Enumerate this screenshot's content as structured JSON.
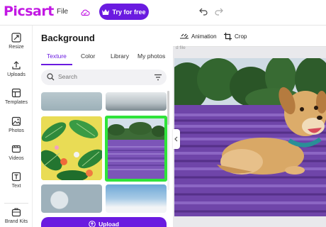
{
  "topbar": {
    "logo": "Picsart",
    "file_menu": "File",
    "try_button": "Try for free"
  },
  "rail": {
    "items": [
      {
        "label": "Resize",
        "icon": "resize-icon"
      },
      {
        "label": "Uploads",
        "icon": "upload-icon"
      },
      {
        "label": "Templates",
        "icon": "templates-icon"
      },
      {
        "label": "Photos",
        "icon": "photos-icon"
      },
      {
        "label": "Videos",
        "icon": "videos-icon"
      },
      {
        "label": "Text",
        "icon": "text-icon"
      },
      {
        "label": "Brand Kits",
        "icon": "brand-kits-icon"
      }
    ]
  },
  "panel": {
    "title": "Background",
    "tabs": [
      {
        "label": "Texture",
        "active": true
      },
      {
        "label": "Color",
        "active": false
      },
      {
        "label": "Library",
        "active": false
      },
      {
        "label": "My photos",
        "active": false
      }
    ],
    "search": {
      "placeholder": "Search"
    },
    "upload_button": "Upload"
  },
  "canvas": {
    "tools": [
      {
        "label": "Animation",
        "icon": "animation-icon"
      },
      {
        "label": "Crop",
        "icon": "crop-icon"
      }
    ],
    "file_label": "d file"
  },
  "colors": {
    "brand": "#c218e3",
    "accent": "#6a1be0",
    "selection": "#2fe33a"
  }
}
